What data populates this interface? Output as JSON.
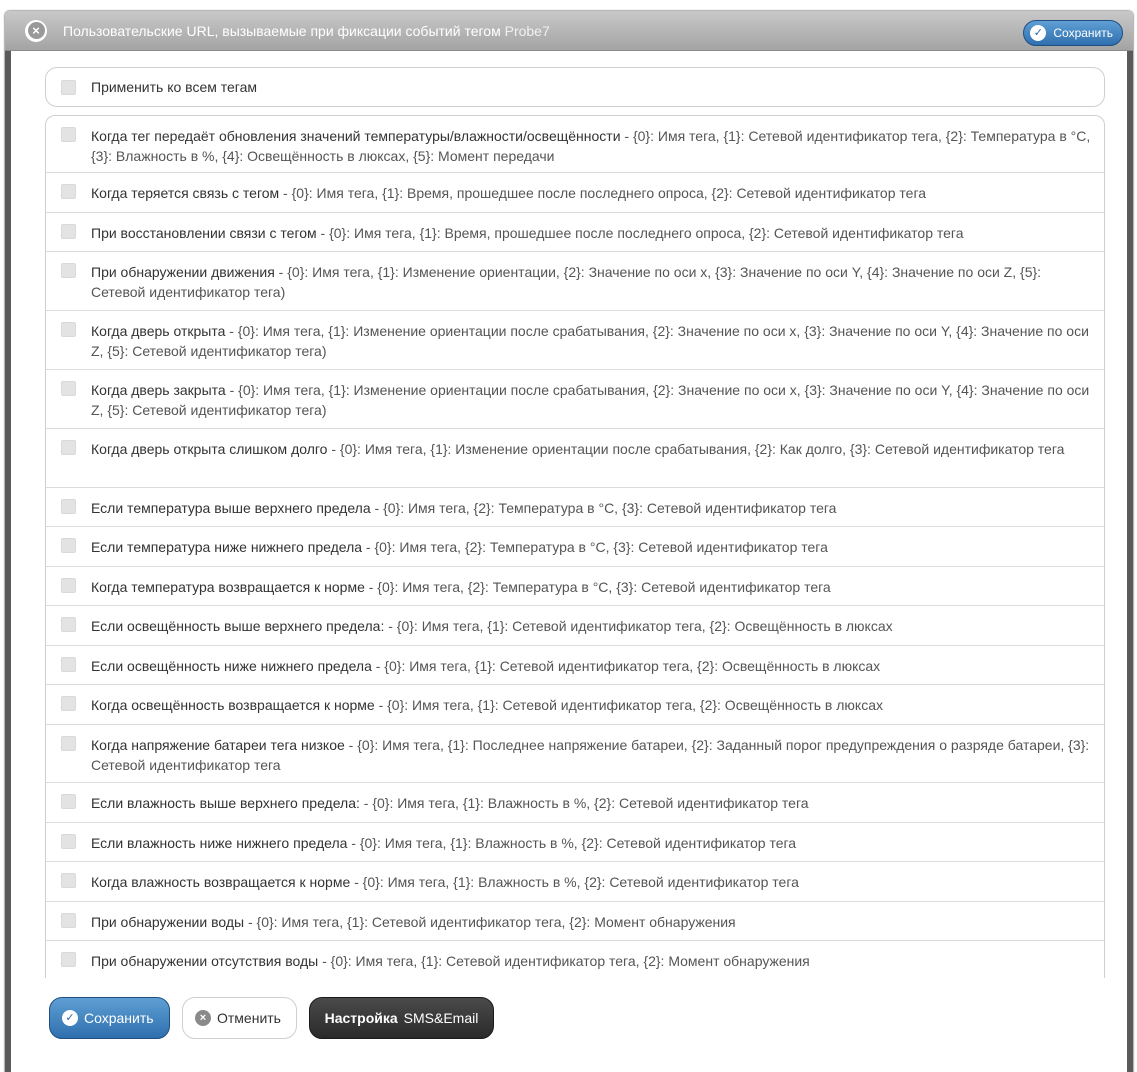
{
  "dialog": {
    "title": "Пользовательские URL, вызываемые при фиксации событий тегом",
    "title_tag": "Probe7",
    "title_save_label": "Сохранить"
  },
  "apply_all": {
    "label": "Применить ко всем тегам",
    "checked": false
  },
  "events": [
    {
      "label": "Когда тег передаёт обновления значений температуры/влажности/освещённости",
      "params": " - {0}: Имя тега, {1}: Сетевой идентификатор тега, {2}: Температура в °C, {3}: Влажность в %, {4}: Освещённость в люксах, {5}: Момент передачи",
      "checked": false
    },
    {
      "label": "Когда теряется связь с тегом",
      "params": " - {0}: Имя тега, {1}: Время, прошедшее после последнего опроса, {2}: Сетевой идентификатор тега",
      "checked": false
    },
    {
      "label": "При восстановлении связи с тегом",
      "params": " - {0}: Имя тега, {1}: Время, прошедшее после последнего опроса, {2}: Сетевой идентификатор тега",
      "checked": false
    },
    {
      "label": "При обнаружении движения",
      "params": " - {0}: Имя тега, {1}: Изменение ориентации, {2}: Значение по оси x, {3}: Значение по оси Y, {4}: Значение по оси Z, {5}: Сетевой идентификатор тега)",
      "checked": false
    },
    {
      "label": "Когда дверь открыта",
      "params": " - {0}: Имя тега, {1}: Изменение ориентации после срабатывания, {2}: Значение по оси x, {3}: Значение по оси Y, {4}: Значение по оси Z, {5}: Сетевой идентификатор тега)",
      "checked": false
    },
    {
      "label": "Когда дверь закрыта",
      "params": " - {0}: Имя тега, {1}: Изменение ориентации после срабатывания, {2}: Значение по оси x, {3}: Значение по оси Y, {4}: Значение по оси Z, {5}: Сетевой идентификатор тега)",
      "checked": false
    },
    {
      "label": "Когда дверь открыта слишком долго",
      "params": " - {0}: Имя тега, {1}: Изменение ориентации после срабатывания, {2}: Как долго, {3}: Сетевой идентификатор тега",
      "checked": false
    },
    {
      "label": "Если температура выше верхнего предела",
      "params": " - {0}: Имя тега, {2}: Температура в °C, {3}: Сетевой идентификатор тега",
      "checked": false
    },
    {
      "label": "Если температура ниже нижнего предела",
      "params": " - {0}: Имя тега, {2}: Температура в °C, {3}: Сетевой идентификатор тега",
      "checked": false
    },
    {
      "label": "Когда температура возвращается к норме",
      "params": " - {0}: Имя тега, {2}: Температура в °C, {3}: Сетевой идентификатор тега",
      "checked": false
    },
    {
      "label": "Если освещённость выше верхнего предела:",
      "params": " - {0}: Имя тега, {1}: Сетевой идентификатор тега, {2}: Освещённость в люксах",
      "checked": false
    },
    {
      "label": "Если освещённость ниже нижнего предела",
      "params": " - {0}: Имя тега, {1}: Сетевой идентификатор тега, {2}: Освещённость в люксах",
      "checked": false
    },
    {
      "label": "Когда освещённость возвращается к норме",
      "params": " - {0}: Имя тега, {1}: Сетевой идентификатор тега, {2}: Освещённость в люксах",
      "checked": false
    },
    {
      "label": "Когда напряжение батареи тега низкое",
      "params": " - {0}: Имя тега, {1}: Последнее напряжение батареи, {2}: Заданный порог предупреждения о разряде батареи, {3}: Сетевой идентификатор тега",
      "checked": false
    },
    {
      "label": "Если влажность выше верхнего предела:",
      "params": " - {0}: Имя тега, {1}: Влажность в %, {2}: Сетевой идентификатор тега",
      "checked": false
    },
    {
      "label": "Если влажность ниже нижнего предела",
      "params": " - {0}: Имя тега, {1}: Влажность в %, {2}: Сетевой идентификатор тега",
      "checked": false
    },
    {
      "label": "Когда влажность возвращается к норме",
      "params": " - {0}: Имя тега, {1}: Влажность в %, {2}: Сетевой идентификатор тега",
      "checked": false
    },
    {
      "label": "При обнаружении воды",
      "params": " - {0}: Имя тега, {1}: Сетевой идентификатор тега, {2}: Момент обнаружения",
      "checked": false
    },
    {
      "label": "При обнаружении отсутствия воды",
      "params": " - {0}: Имя тега, {1}: Сетевой идентификатор тега, {2}: Момент обнаружения",
      "checked": false
    }
  ],
  "footer": {
    "save_label": "Сохранить",
    "cancel_label": "Отменить",
    "sms_label_bold": "Настройка",
    "sms_label_rest": " SMS&Email"
  },
  "icons": {
    "close": "close-circle-icon",
    "check": "check-circle-icon",
    "cancel": "x-circle-icon"
  },
  "colors": {
    "primary": "#2f6fae",
    "titlebar": "#a4a4a4",
    "dark_button": "#2a2a2a"
  }
}
